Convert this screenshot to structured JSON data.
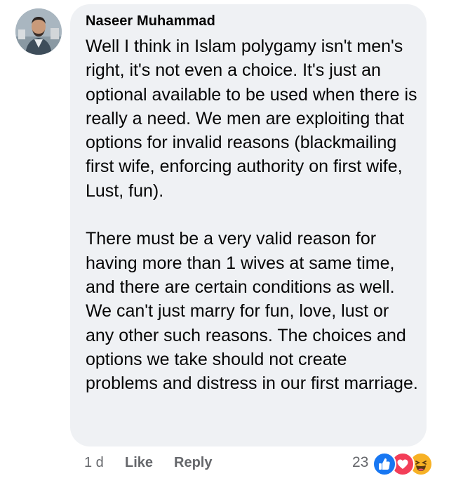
{
  "comment": {
    "author": "Naseer Muhammad",
    "paragraphs": [
      "Well I think in Islam polygamy isn't men's right, it's not even a choice. It's just an optional available to be used when there is really a need. We men are exploiting that options for invalid reasons (blackmailing first wife, enforcing authority on first wife, Lust, fun).",
      "There must be a very valid reason for having more than 1 wives at same time, and there are certain conditions as well. We can't just marry for fun, love, lust or any other such reasons. The choices and options we take should not create problems and distress in our first marriage."
    ],
    "time": "1 d",
    "like_label": "Like",
    "reply_label": "Reply",
    "reaction_count": "23",
    "reactions": [
      "like-icon",
      "love-icon",
      "haha-icon"
    ]
  },
  "colors": {
    "bubble": "#eff1f4",
    "meta_text": "#65676b",
    "like_blue": "#1877f2",
    "love_red": "#f33e58",
    "haha_yellow": "#f7b125"
  }
}
